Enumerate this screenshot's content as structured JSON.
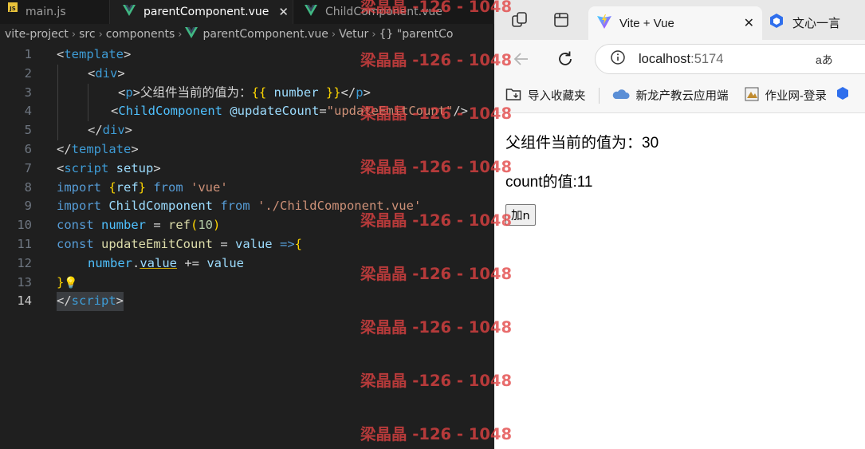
{
  "editor": {
    "tabs": [
      {
        "label": "main.js",
        "active": false
      },
      {
        "label": "parentComponent.vue",
        "active": true
      },
      {
        "label": "ChildComponent.vue",
        "active": false
      }
    ],
    "breadcrumb": [
      "vite-project",
      "src",
      "components",
      "parentComponent.vue",
      "Vetur",
      "{} \"parentCo"
    ],
    "line_numbers": [
      "1",
      "2",
      "3",
      "4",
      "5",
      "6",
      "7",
      "8",
      "9",
      "10",
      "11",
      "12",
      "13",
      "14"
    ],
    "code": {
      "l1": {
        "open": "<",
        "tag": "template",
        "close": ">"
      },
      "l2": {
        "open": "<",
        "tag": "div",
        "close": ">"
      },
      "l3": {
        "open": "<",
        "tag": "p",
        "close": ">",
        "text": "父组件当前的值为：",
        "mo": "{{",
        "expr": " number ",
        "mc": "}}",
        "end": "</",
        "endtag": "p",
        "endclose": ">"
      },
      "l4": {
        "open": "<",
        "tag": "ChildComponent",
        "attr": " @updateCount",
        "eq": "=",
        "value": "\"updateEmitCount\"",
        "close": "/>"
      },
      "l5": {
        "open": "</",
        "tag": "div",
        "close": ">"
      },
      "l6": {
        "open": "</",
        "tag": "template",
        "close": ">"
      },
      "l7": {
        "open": "<",
        "tag": "script",
        "attr": " setup",
        "close": ">"
      },
      "l8": {
        "kw": "import",
        "b1": " {",
        "id": "ref",
        "b2": "}",
        "from": " from",
        "str": " 'vue'"
      },
      "l9": {
        "kw": "import",
        "id": " ChildComponent",
        "from": " from",
        "str": " './ChildComponent.vue'"
      },
      "l10": {
        "kw": "const",
        "id": " number",
        "op": " = ",
        "fn": "ref",
        "p1": "(",
        "num": "10",
        "p2": ")"
      },
      "l11": {
        "kw": "const",
        "id": " updateEmitCount",
        "op": " = ",
        "param": "value",
        "arrow": " =>",
        "brace": "{"
      },
      "l12": {
        "obj": "number",
        "dot": ".",
        "prop": "value",
        "op": " += ",
        "val": "value"
      },
      "l13": {
        "brace": "}",
        "bulb": "💡"
      },
      "l14": {
        "open": "</",
        "tag": "script",
        "close": ">"
      }
    }
  },
  "browser": {
    "active_tab": "Vite + Vue",
    "other_tab": "文心一言",
    "url_host": "localhost",
    "url_port": ":5174",
    "read_aloud": "aあ",
    "bookmarks": [
      "导入收藏夹",
      "新龙产教云应用端",
      "作业网-登录"
    ],
    "page": {
      "parent_value_text": "父组件当前的值为：30",
      "count_text": "count的值:11",
      "add_button": "加n"
    }
  },
  "watermark": "梁晶晶 -126 - 1048",
  "colors": {
    "editor_bg": "#1f1f1f",
    "watermark": "#e24242",
    "vue_green": "#41b883",
    "browser_chrome": "#e8e8e8"
  },
  "icons": {
    "vue_file": "vue-logo-icon",
    "js_file": "js-file-icon",
    "back": "arrow-left-icon",
    "refresh": "refresh-icon",
    "info": "info-icon",
    "favicon": "vite-logo-icon"
  }
}
